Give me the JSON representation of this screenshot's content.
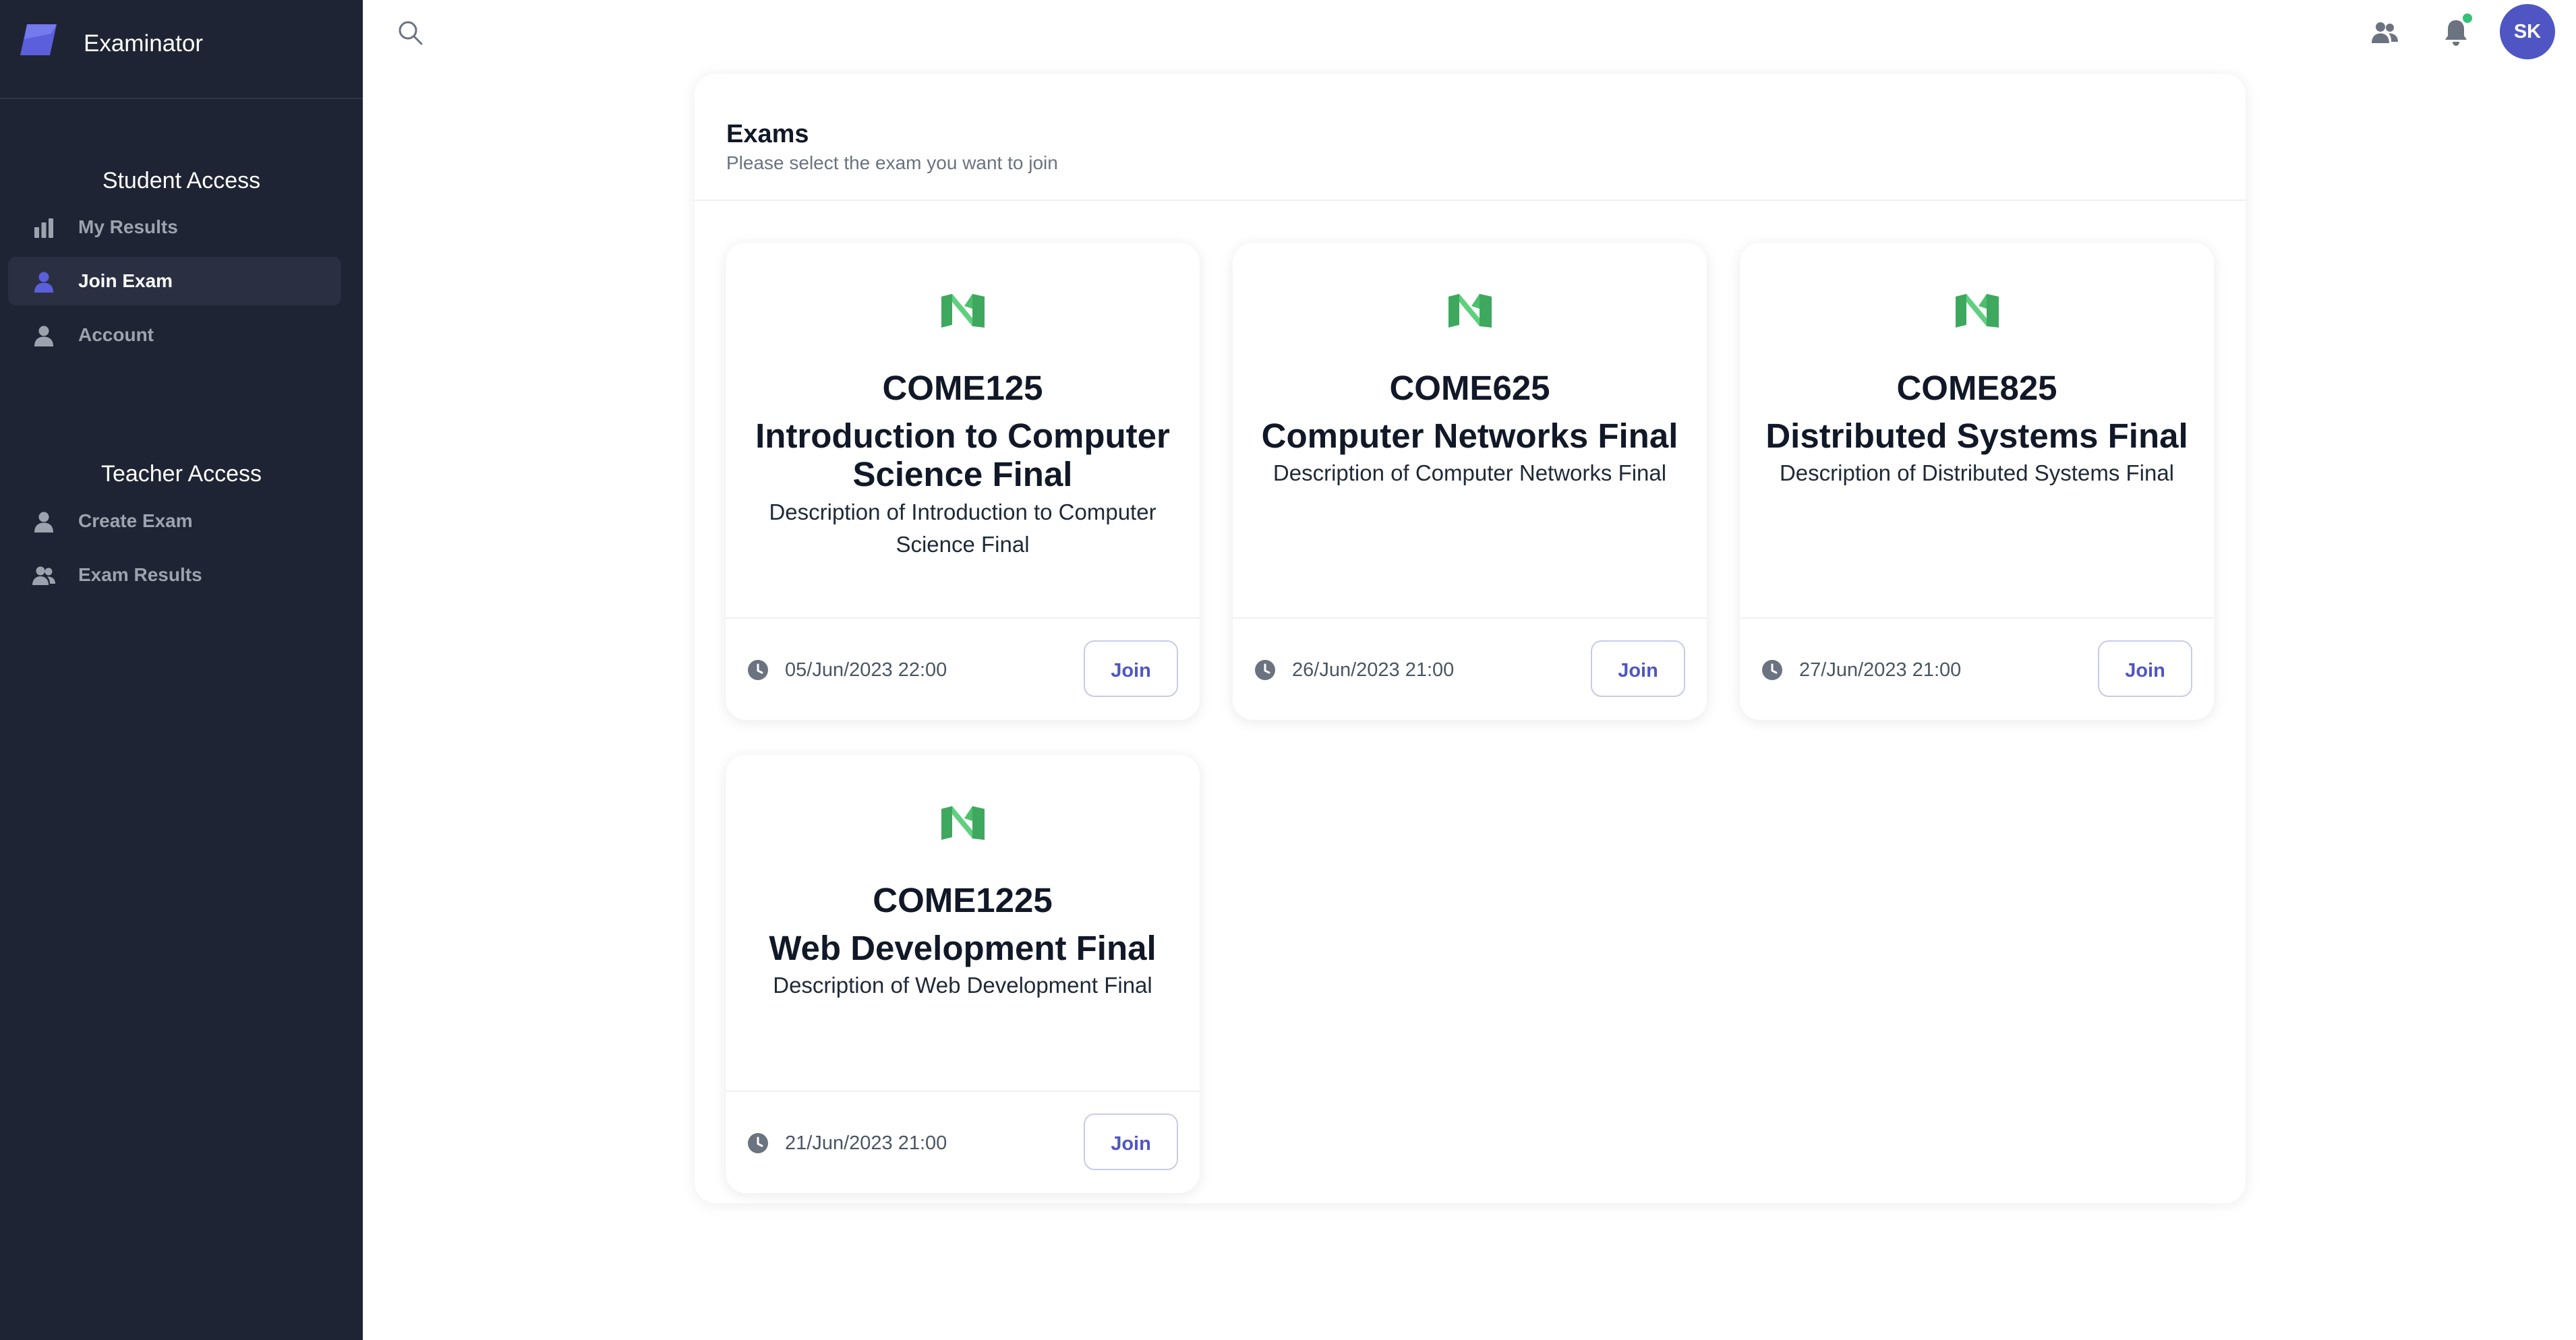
{
  "app": {
    "name": "Examinator",
    "accent": "#4f56c4",
    "sidebar_bg": "#1f2434"
  },
  "sidebar": {
    "student_section": "Student Access",
    "student_items": [
      {
        "label": "My Results",
        "icon": "bar-chart-icon",
        "active": false
      },
      {
        "label": "Join Exam",
        "icon": "user-icon",
        "active": true
      },
      {
        "label": "Account",
        "icon": "user-icon",
        "active": false
      }
    ],
    "teacher_section": "Teacher Access",
    "teacher_items": [
      {
        "label": "Create Exam",
        "icon": "user-icon",
        "active": false
      },
      {
        "label": "Exam Results",
        "icon": "users-icon",
        "active": false
      }
    ]
  },
  "topbar": {
    "search_icon": "search-icon",
    "users_icon": "users-icon",
    "bell_icon": "bell-icon",
    "notification_dot_color": "#34c17a",
    "avatar_initials": "SK"
  },
  "panel": {
    "title": "Exams",
    "subtitle": "Please select the exam you want to join"
  },
  "exams": [
    {
      "code": "COME125",
      "title": "Introduction to Computer Science Final",
      "description": "Description of Introduction to Computer Science Final",
      "date": "05/Jun/2023 22:00",
      "join_label": "Join"
    },
    {
      "code": "COME625",
      "title": "Computer Networks Final",
      "description": "Description of Computer Networks Final",
      "date": "26/Jun/2023 21:00",
      "join_label": "Join"
    },
    {
      "code": "COME825",
      "title": "Distributed Systems Final",
      "description": "Description of Distributed Systems Final",
      "date": "27/Jun/2023 21:00",
      "join_label": "Join"
    },
    {
      "code": "COME1225",
      "title": "Web Development Final",
      "description": "Description of Web Development Final",
      "date": "21/Jun/2023 21:00",
      "join_label": "Join"
    }
  ]
}
